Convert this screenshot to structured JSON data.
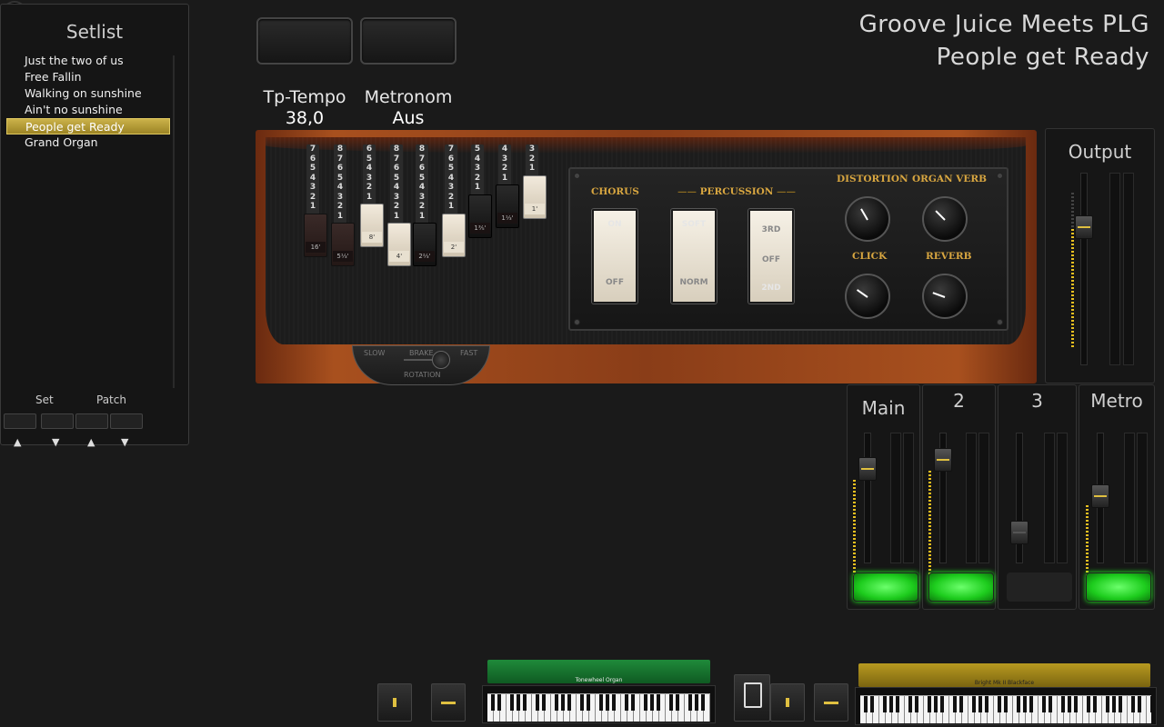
{
  "close": {
    "icon": "close-icon"
  },
  "setlist": {
    "title": "Setlist",
    "items": [
      "Just the two of us",
      "Free Fallin",
      "Walking on sunshine",
      "Ain't no sunshine",
      "People get Ready",
      "Grand Organ"
    ],
    "selected_index": 4,
    "set_label": "Set",
    "patch_label": "Patch",
    "up_arrow": "▲",
    "down_arrow": "▼"
  },
  "header": {
    "song_title": "Groove Juice Meets PLG",
    "patch_title": "People get Ready"
  },
  "params": {
    "tempo_label": "Tp-Tempo",
    "tempo_value": "38,0",
    "metronome_label": "Metronom",
    "metronome_value": "Aus"
  },
  "organ": {
    "drawbars": [
      {
        "foot": "16'",
        "nums": [
          "7",
          "6",
          "5",
          "4",
          "3",
          "2",
          "1"
        ],
        "level": 7,
        "color": "brown"
      },
      {
        "foot": "5⅓'",
        "nums": [
          "8",
          "7",
          "6",
          "5",
          "4",
          "3",
          "2",
          "1"
        ],
        "level": 8,
        "color": "brown"
      },
      {
        "foot": "8'",
        "nums": [
          "6",
          "5",
          "4",
          "3",
          "2",
          "1"
        ],
        "level": 6,
        "color": "white"
      },
      {
        "foot": "4'",
        "nums": [
          "8",
          "7",
          "6",
          "5",
          "4",
          "3",
          "2",
          "1"
        ],
        "level": 8,
        "color": "white"
      },
      {
        "foot": "2⅔'",
        "nums": [
          "8",
          "7",
          "6",
          "5",
          "4",
          "3",
          "2",
          "1"
        ],
        "level": 8,
        "color": "black"
      },
      {
        "foot": "2'",
        "nums": [
          "7",
          "6",
          "5",
          "4",
          "3",
          "2",
          "1"
        ],
        "level": 7,
        "color": "white"
      },
      {
        "foot": "1⅗'",
        "nums": [
          "5",
          "4",
          "3",
          "2",
          "1"
        ],
        "level": 5,
        "color": "black"
      },
      {
        "foot": "1⅓'",
        "nums": [
          "4",
          "3",
          "2",
          "1"
        ],
        "level": 4,
        "color": "black"
      },
      {
        "foot": "1'",
        "nums": [
          "3",
          "2",
          "1"
        ],
        "level": 3,
        "color": "white"
      }
    ],
    "chorus": {
      "label": "CHORUS",
      "on": "ON",
      "off": "OFF"
    },
    "percussion": {
      "label": "PERCUSSION",
      "soft": "SOFT",
      "norm": "NORM",
      "third": "3RD",
      "off": "OFF",
      "second": "2ND"
    },
    "knobs": {
      "distortion": "DISTORTION",
      "organ_verb": "ORGAN VERB",
      "click": "CLICK",
      "reverb": "REVERB"
    },
    "rotation": {
      "slow": "SLOW",
      "brake": "BRAKE",
      "fast": "FAST",
      "label": "ROTATION"
    }
  },
  "mixer": {
    "output_title": "Output",
    "channels": [
      {
        "name": "Main",
        "active": true
      },
      {
        "name": "2",
        "active": true
      },
      {
        "name": "3",
        "active": false
      },
      {
        "name": "Metro",
        "active": true
      }
    ]
  },
  "bottom": {
    "kbd1_label": "Tonewheel Organ",
    "kbd2_label": "Bright Mk II Blackface",
    "kbd1_color": "#1f8a3a",
    "kbd2_color": "#b89a20"
  }
}
